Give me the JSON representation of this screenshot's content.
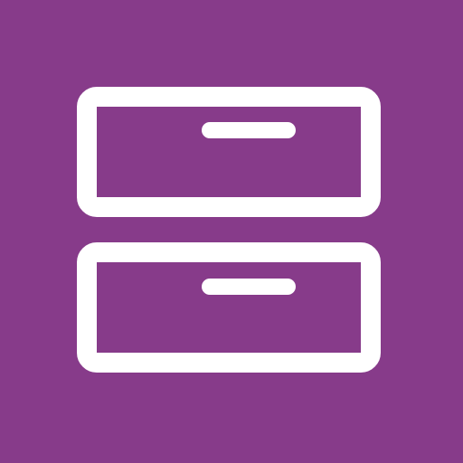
{
  "icon": {
    "name": "file-cabinet-icon",
    "colors": {
      "background": "#873b8a",
      "foreground": "#ffffff"
    },
    "drawers": [
      {
        "name": "drawer-top"
      },
      {
        "name": "drawer-bottom"
      }
    ]
  }
}
